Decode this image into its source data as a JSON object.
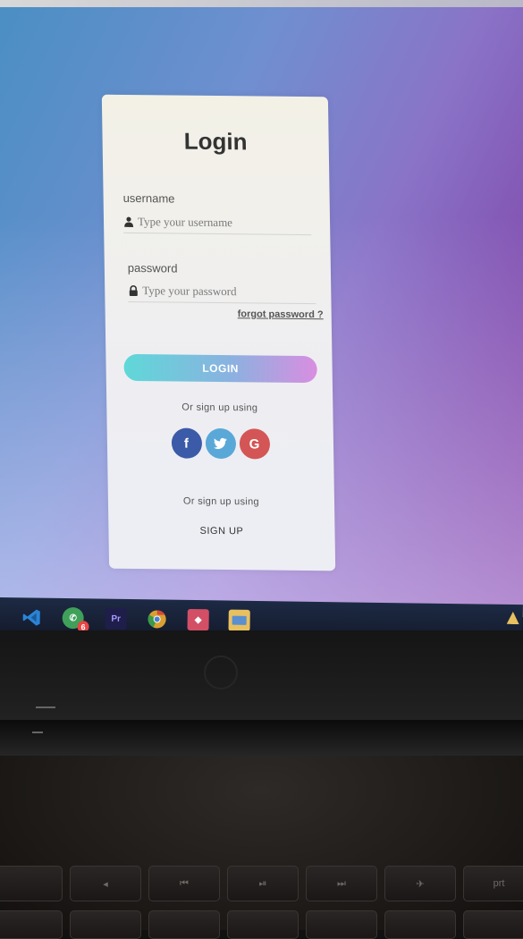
{
  "login_card": {
    "title": "Login",
    "username_label": "username",
    "username_placeholder": "Type your username",
    "password_label": "password",
    "password_placeholder": "Type your password",
    "forgot_link": "forgot password ?",
    "login_button": "LOGIN",
    "social_prompt": "Or sign up using",
    "social_buttons": [
      {
        "name": "facebook",
        "glyph": "f",
        "color": "#3b5ba8"
      },
      {
        "name": "twitter",
        "glyph": "🐦",
        "color": "#5aa8d8"
      },
      {
        "name": "google",
        "glyph": "G",
        "color": "#d45555"
      }
    ],
    "signup_prompt": "Or sign up using",
    "signup_link": "SIGN UP"
  },
  "taskbar": {
    "items": [
      {
        "name": "vscode-icon",
        "glyph": "⟩⟨",
        "color": "#2a7fd4"
      },
      {
        "name": "whatsapp-icon",
        "glyph": "✆",
        "color": "#3fa05a",
        "badge": "6"
      },
      {
        "name": "premiere-icon",
        "glyph": "Pr",
        "color": "#1f1e4a"
      },
      {
        "name": "chrome-icon",
        "glyph": "◉",
        "color": "#d8a030"
      },
      {
        "name": "app-red-icon",
        "glyph": "◆",
        "color": "#d24f66"
      },
      {
        "name": "file-explorer-icon",
        "glyph": "▭",
        "color": "#e8c060"
      }
    ]
  },
  "keyboard": {
    "row1": [
      "",
      "◂",
      "⏮",
      "⏯",
      "⏭",
      "✈",
      "prt"
    ]
  },
  "colors": {
    "login_gradient_start": "#5fd8d8",
    "login_gradient_end": "#d98ee0",
    "card_bg": "#f1f0ea"
  }
}
